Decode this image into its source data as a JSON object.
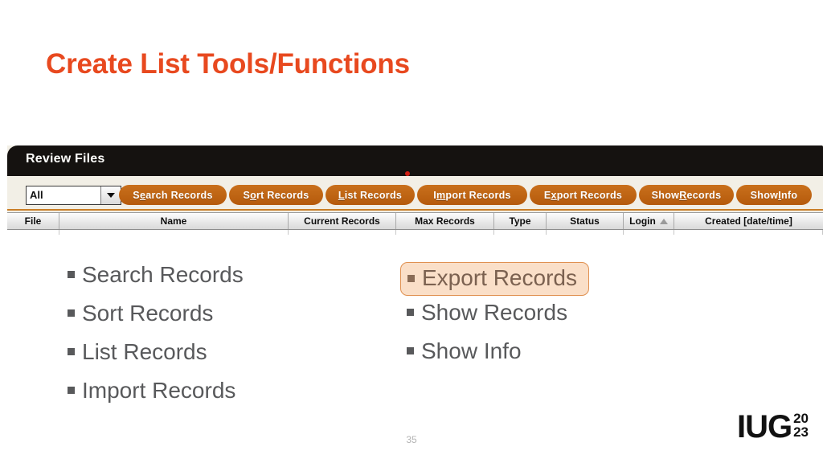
{
  "slide": {
    "title": "Create List Tools/Functions",
    "page_number": "35",
    "title_color": "#e8491f"
  },
  "app": {
    "titlebar": {
      "label": "Review Files"
    },
    "toolbar": {
      "filter": {
        "value": "All",
        "arrow_icon": "chevron-down-icon"
      },
      "buttons": [
        {
          "name": "search-records-button",
          "prefix": "S",
          "accesskey": "e",
          "suffix": "arch Records",
          "label": "Search Records"
        },
        {
          "name": "sort-records-button",
          "prefix": "S",
          "accesskey": "o",
          "suffix": "rt Records",
          "label": "Sort Records"
        },
        {
          "name": "list-records-button",
          "prefix": "",
          "accesskey": "L",
          "suffix": "ist Records",
          "label": "List Records"
        },
        {
          "name": "import-records-button",
          "prefix": "I",
          "accesskey": "m",
          "suffix": "port Records",
          "label": "Import Records"
        },
        {
          "name": "export-records-button",
          "prefix": "E",
          "accesskey": "x",
          "suffix": "port Records",
          "label": "Export Records"
        },
        {
          "name": "show-records-button",
          "prefix": "Show ",
          "accesskey": "R",
          "suffix": "ecords",
          "label": "Show Records"
        },
        {
          "name": "show-info-button",
          "prefix": "Show ",
          "accesskey": "I",
          "suffix": "nfo",
          "label": "Show Info"
        }
      ]
    },
    "table": {
      "columns": [
        {
          "label": "File",
          "sort": ""
        },
        {
          "label": "Name",
          "sort": ""
        },
        {
          "label": "Current Records",
          "sort": ""
        },
        {
          "label": "Max Records",
          "sort": ""
        },
        {
          "label": "Type",
          "sort": ""
        },
        {
          "label": "Status",
          "sort": ""
        },
        {
          "label": "Login",
          "sort": "ascending"
        },
        {
          "label": "Created [date/time]",
          "sort": ""
        }
      ]
    },
    "accent_color": "#bf5f10",
    "titlebar_color": "#151210"
  },
  "bullets": {
    "left": [
      {
        "label": "Search Records",
        "highlighted": false
      },
      {
        "label": "Sort Records",
        "highlighted": false
      },
      {
        "label": "List Records",
        "highlighted": false
      },
      {
        "label": "Import Records",
        "highlighted": false
      }
    ],
    "right": [
      {
        "label": "Export Records",
        "highlighted": true
      },
      {
        "label": "Show Records",
        "highlighted": false
      },
      {
        "label": "Show Info",
        "highlighted": false
      }
    ],
    "highlight_fill": "#fadfc8",
    "highlight_border": "#e09050"
  },
  "logo": {
    "main": "IUG",
    "year_top": "20",
    "year_bottom": "23"
  }
}
